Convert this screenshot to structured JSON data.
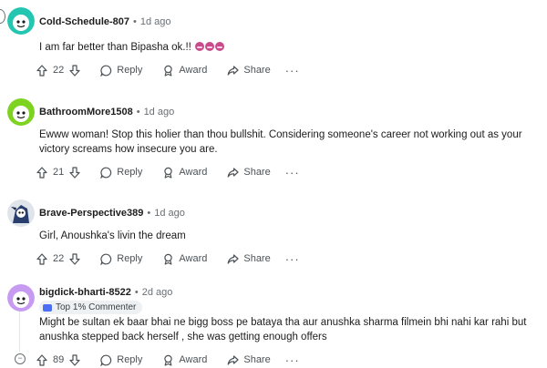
{
  "comments": [
    {
      "username": "Cold-Schedule-807",
      "time": "1d ago",
      "text": "I am far better than Bipasha ok.!!",
      "emoji_count": 3,
      "score": "22",
      "avatar_color": "#24c6b2"
    },
    {
      "username": "BathroomMore1508",
      "time": "1d ago",
      "text": "Ewww woman! Stop this holier than thou bullshit. Considering someone's career not working out as your victory screams how insecure you are.",
      "score": "21",
      "avatar_color": "#7ed321"
    },
    {
      "username": "Brave-Perspective389",
      "time": "1d ago",
      "text": "Girl, Anoushka's livin the dream",
      "score": "22",
      "avatar_color": "#2a3e6e"
    },
    {
      "username": "bigdick-bharti-8522",
      "time": "2d ago",
      "flair": "Top 1% Commenter",
      "text": "Might be sultan ek baar bhai ne bigg boss pe bataya tha aur anushka sharma filmein bhi nahi kar rahi but anushka stepped back herself , she was getting enough offers",
      "score": "89",
      "avatar_color": "#c79bf2"
    }
  ],
  "actions": {
    "reply": "Reply",
    "award": "Award",
    "share": "Share",
    "more": "···"
  },
  "collapse_symbol": "−"
}
